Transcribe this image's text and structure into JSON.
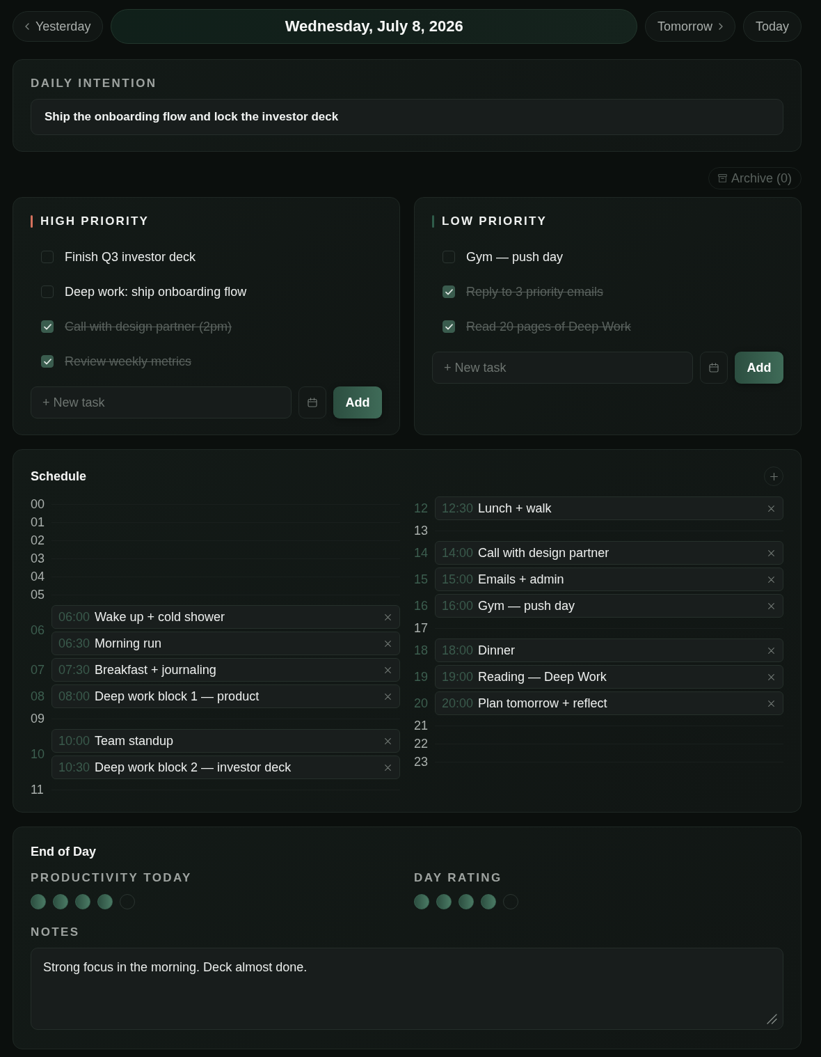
{
  "nav": {
    "previous": "Yesterday",
    "date": "Wednesday, July 8, 2026",
    "next": "Tomorrow",
    "today": "Today"
  },
  "intention": {
    "label": "DAILY INTENTION",
    "value": "Ship the onboarding flow and lock the investor deck"
  },
  "archive": {
    "label": "Archive (0)"
  },
  "lists": [
    {
      "title": "HIGH PRIORITY",
      "color": "#d3705c",
      "tasks": [
        {
          "text": "Finish Q3 investor deck",
          "checked": false
        },
        {
          "text": "Deep work: ship onboarding flow",
          "checked": false
        },
        {
          "text": "Call with design partner (2pm)",
          "checked": true
        },
        {
          "text": "Review weekly metrics",
          "checked": true
        }
      ],
      "new_task": {
        "placeholder": "+ New task"
      },
      "add_button": "Add"
    },
    {
      "title": "LOW PRIORITY",
      "color": "#2f5c4a",
      "tasks": [
        {
          "text": "Gym — push day",
          "checked": false
        },
        {
          "text": "Reply to 3 priority emails",
          "checked": true
        },
        {
          "text": "Read 20 pages of Deep Work",
          "checked": true
        }
      ],
      "new_task": {
        "placeholder": "+ New task"
      },
      "add_button": "Add"
    }
  ],
  "schedule": {
    "title": "Schedule",
    "columns": [
      {
        "hours": [
          {
            "hour": "00"
          },
          {
            "hour": "01"
          },
          {
            "hour": "02"
          },
          {
            "hour": "03"
          },
          {
            "hour": "04"
          },
          {
            "hour": "05"
          },
          {
            "hour": "06",
            "events": [
              {
                "time": "06:00",
                "title": "Wake up + cold shower"
              },
              {
                "time": "06:30",
                "title": "Morning run"
              }
            ]
          },
          {
            "hour": "07",
            "events": [
              {
                "time": "07:30",
                "title": "Breakfast + journaling"
              }
            ]
          },
          {
            "hour": "08",
            "events": [
              {
                "time": "08:00",
                "title": "Deep work block 1 — product"
              }
            ]
          },
          {
            "hour": "09"
          },
          {
            "hour": "10",
            "events": [
              {
                "time": "10:00",
                "title": "Team standup"
              },
              {
                "time": "10:30",
                "title": "Deep work block 2 — investor deck"
              }
            ]
          },
          {
            "hour": "11"
          }
        ]
      },
      {
        "hours": [
          {
            "hour": "12",
            "events": [
              {
                "time": "12:30",
                "title": "Lunch + walk"
              }
            ]
          },
          {
            "hour": "13"
          },
          {
            "hour": "14",
            "events": [
              {
                "time": "14:00",
                "title": "Call with design partner"
              }
            ]
          },
          {
            "hour": "15",
            "events": [
              {
                "time": "15:00",
                "title": "Emails + admin"
              }
            ]
          },
          {
            "hour": "16",
            "events": [
              {
                "time": "16:00",
                "title": "Gym — push day"
              }
            ]
          },
          {
            "hour": "17"
          },
          {
            "hour": "18",
            "events": [
              {
                "time": "18:00",
                "title": "Dinner"
              }
            ]
          },
          {
            "hour": "19",
            "events": [
              {
                "time": "19:00",
                "title": "Reading — Deep Work"
              }
            ]
          },
          {
            "hour": "20",
            "events": [
              {
                "time": "20:00",
                "title": "Plan tomorrow + reflect"
              }
            ]
          },
          {
            "hour": "21"
          },
          {
            "hour": "22"
          },
          {
            "hour": "23"
          }
        ]
      }
    ]
  },
  "end_of_day": {
    "title": "End of Day",
    "ratings": [
      {
        "label": "PRODUCTIVITY TODAY",
        "stars": 4
      },
      {
        "label": "DAY RATING",
        "stars": 4
      }
    ],
    "notes": {
      "label": "NOTES",
      "value": "Strong focus in the morning. Deck almost done."
    }
  }
}
